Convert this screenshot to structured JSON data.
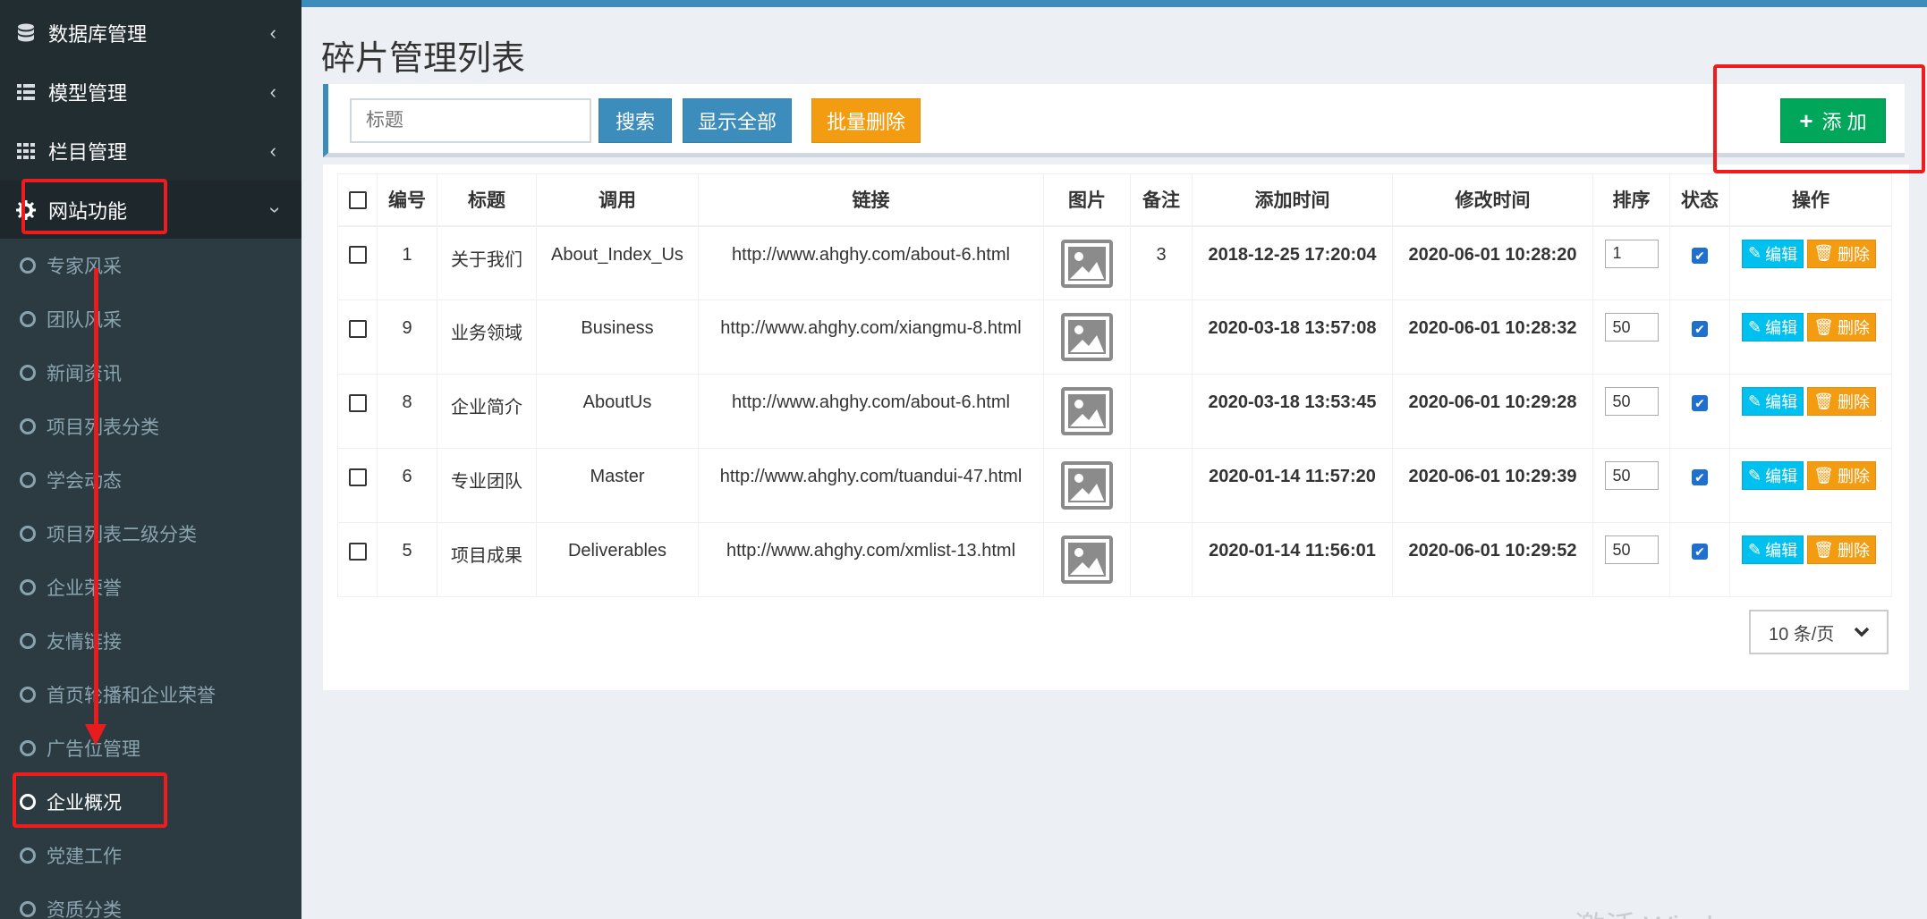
{
  "sidebar": {
    "menus": [
      {
        "label": "数据库管理",
        "icon": "database-icon"
      },
      {
        "label": "模型管理",
        "icon": "list-icon"
      },
      {
        "label": "栏目管理",
        "icon": "grid-icon"
      },
      {
        "label": "网站功能",
        "icon": "gear-icon"
      }
    ],
    "sub_items": [
      {
        "label": "专家风采"
      },
      {
        "label": "团队风采"
      },
      {
        "label": "新闻资讯"
      },
      {
        "label": "项目列表分类"
      },
      {
        "label": "学会动态"
      },
      {
        "label": "项目列表二级分类"
      },
      {
        "label": "企业荣誉"
      },
      {
        "label": "友情链接"
      },
      {
        "label": "首页轮播和企业荣誉"
      },
      {
        "label": "广告位管理"
      },
      {
        "label": "企业概况"
      },
      {
        "label": "党建工作"
      },
      {
        "label": "资质分类"
      }
    ],
    "active_sub": "企业概况"
  },
  "page": {
    "title": "碎片管理列表"
  },
  "toolbar": {
    "search_placeholder": "标题",
    "search_label": "搜索",
    "show_all_label": "显示全部",
    "batch_delete_label": "批量删除",
    "add_label": "添 加",
    "add_icon": "+"
  },
  "table": {
    "headers": [
      "编号",
      "标题",
      "调用",
      "链接",
      "图片",
      "备注",
      "添加时间",
      "修改时间",
      "排序",
      "状态",
      "操作"
    ],
    "rows": [
      {
        "id": "1",
        "title": "关于我们",
        "call": "About_Index_Us",
        "link": "http://www.ahghy.com/about-6.html",
        "note": "3",
        "added": "2018-12-25 17:20:04",
        "modified": "2020-06-01 10:28:20",
        "sort": "1",
        "status_checked": true
      },
      {
        "id": "9",
        "title": "业务领域",
        "call": "Business",
        "link": "http://www.ahghy.com/xiangmu-8.html",
        "note": "",
        "added": "2020-03-18 13:57:08",
        "modified": "2020-06-01 10:28:32",
        "sort": "50",
        "status_checked": true
      },
      {
        "id": "8",
        "title": "企业简介",
        "call": "AboutUs",
        "link": "http://www.ahghy.com/about-6.html",
        "note": "",
        "added": "2020-03-18 13:53:45",
        "modified": "2020-06-01 10:29:28",
        "sort": "50",
        "status_checked": true
      },
      {
        "id": "6",
        "title": "专业团队",
        "call": "Master",
        "link": "http://www.ahghy.com/tuandui-47.html",
        "note": "",
        "added": "2020-01-14 11:57:20",
        "modified": "2020-06-01 10:29:39",
        "sort": "50",
        "status_checked": true
      },
      {
        "id": "5",
        "title": "项目成果",
        "call": "Deliverables",
        "link": "http://www.ahghy.com/xmlist-13.html",
        "note": "",
        "added": "2020-01-14 11:56:01",
        "modified": "2020-06-01 10:29:52",
        "sort": "50",
        "status_checked": true
      }
    ],
    "edit_label": "编辑",
    "delete_label": "删除"
  },
  "pager": {
    "per_page": "10 条/页"
  },
  "colors": {
    "sidebar_bg": "#222d32",
    "submenu_bg": "#2c3b41",
    "primary": "#3c8dbc",
    "warning": "#f39c12",
    "success": "#00a65a",
    "info": "#00c0ef",
    "annotation_red": "#ee1c1c"
  },
  "watermark": "激活 Windows"
}
